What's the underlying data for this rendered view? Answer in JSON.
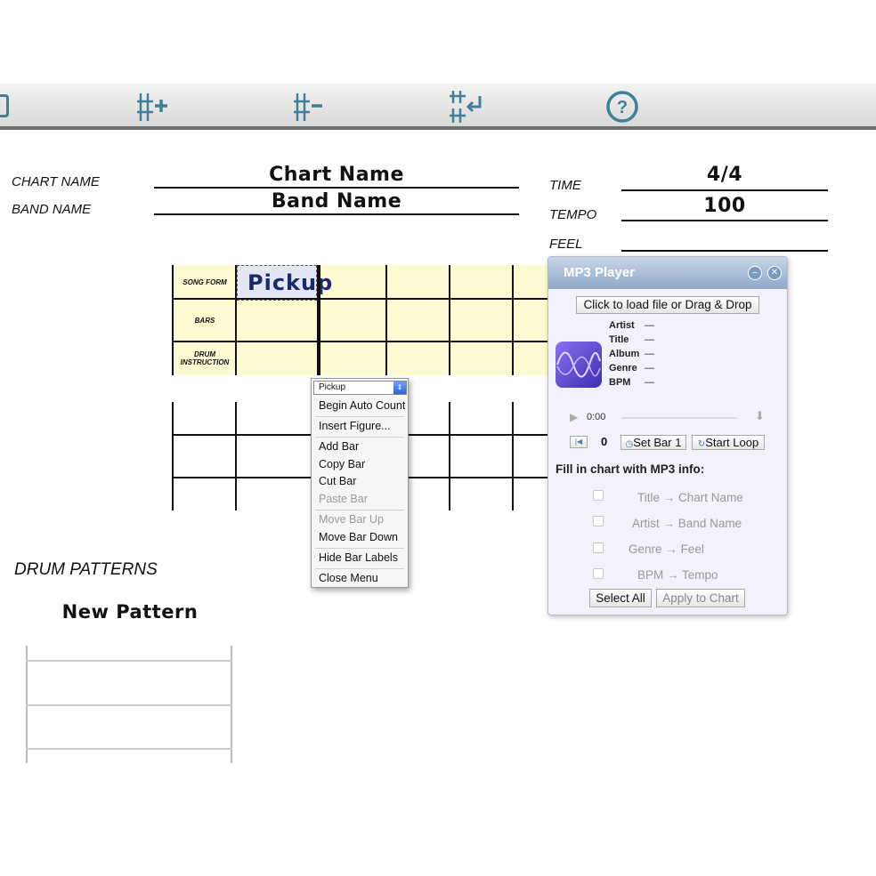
{
  "toolbar": {
    "buttons": [
      {
        "name": "add-bar",
        "icon": "bar-plus-icon"
      },
      {
        "name": "remove-bar",
        "icon": "bar-minus-icon"
      },
      {
        "name": "line-break",
        "icon": "bar-return-icon"
      },
      {
        "name": "help",
        "icon": "help-icon"
      }
    ],
    "accent_color": "#3f7f97"
  },
  "chart": {
    "chart_name_label": "CHART NAME",
    "band_name_label": "BAND NAME",
    "chart_name": "Chart Name",
    "band_name": "Band Name",
    "time_label": "TIME",
    "tempo_label": "TEMPO",
    "feel_label": "FEEL",
    "time_value": "4/4",
    "tempo_value": "100",
    "feel_value": ""
  },
  "grid": {
    "row_labels": [
      "SONG FORM",
      "BARS",
      "DRUM INSTRUCTION"
    ],
    "pickup_text": "Pickup",
    "background": "#fefbd2"
  },
  "context_menu": {
    "selected": "Pickup",
    "items": [
      {
        "label": "Begin Auto Count",
        "enabled": true
      },
      {
        "label": "Insert Figure...",
        "enabled": true
      },
      {
        "label": "Add Bar",
        "enabled": true
      },
      {
        "label": "Copy Bar",
        "enabled": true
      },
      {
        "label": "Cut Bar",
        "enabled": true
      },
      {
        "label": "Paste Bar",
        "enabled": false
      },
      {
        "label": "Move Bar Up",
        "enabled": false
      },
      {
        "label": "Move Bar Down",
        "enabled": true
      },
      {
        "label": "Hide Bar Labels",
        "enabled": true
      },
      {
        "label": "Close Menu",
        "enabled": true
      }
    ]
  },
  "mp3": {
    "title": "MP3 Player",
    "load_label": "Click to load file or Drag & Drop",
    "meta": [
      {
        "key": "Artist",
        "value": "—"
      },
      {
        "key": "Title",
        "value": "—"
      },
      {
        "key": "Album",
        "value": "—"
      },
      {
        "key": "Genre",
        "value": "—"
      },
      {
        "key": "BPM",
        "value": "—"
      }
    ],
    "time": "0:00",
    "bar_count": "0",
    "set_bar_label": "Set Bar 1",
    "start_loop_label": "Start Loop",
    "fill_heading": "Fill in chart with MP3 info:",
    "mappings": [
      {
        "from": "Title",
        "to": "Chart Name"
      },
      {
        "from": "Artist",
        "to": "Band Name"
      },
      {
        "from": "Genre",
        "to": "Feel"
      },
      {
        "from": "BPM",
        "to": "Tempo"
      }
    ],
    "arrow": "→",
    "select_all_label": "Select All",
    "apply_label": "Apply to Chart"
  },
  "drum": {
    "heading": "DRUM PATTERNS",
    "pattern_name": "New Pattern"
  }
}
